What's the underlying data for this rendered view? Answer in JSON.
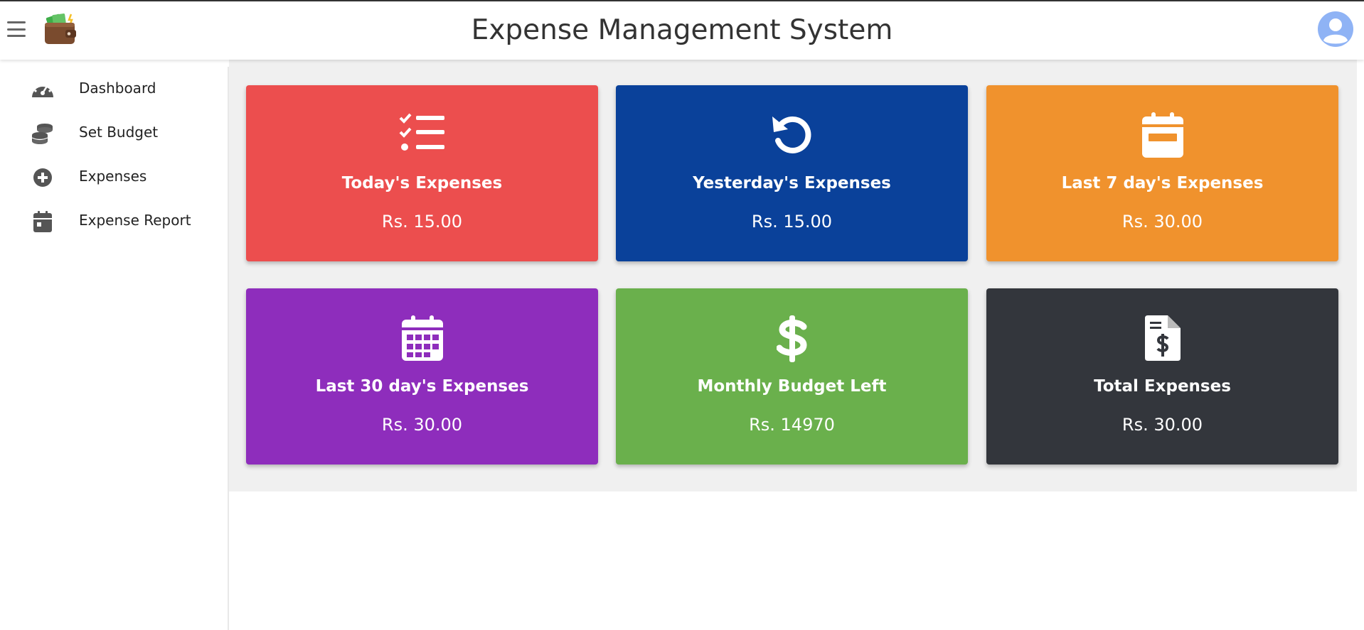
{
  "header": {
    "title": "Expense Management System"
  },
  "sidebar": {
    "items": [
      {
        "label": "Dashboard",
        "icon": "dashboard-gauge-icon"
      },
      {
        "label": "Set Budget",
        "icon": "coins-stack-icon"
      },
      {
        "label": "Expenses",
        "icon": "plus-circle-icon"
      },
      {
        "label": "Expense Report",
        "icon": "calendar-icon"
      }
    ]
  },
  "cards": [
    {
      "title": "Today's Expenses",
      "value": "Rs. 15.00",
      "color": "#ec4e4e",
      "icon": "list-check-icon"
    },
    {
      "title": "Yesterday's Expenses",
      "value": "Rs. 15.00",
      "color": "#0a419a",
      "icon": "rotate-left-icon"
    },
    {
      "title": "Last 7 day's Expenses",
      "value": "Rs. 30.00",
      "color": "#f0922d",
      "icon": "calendar-week-icon"
    },
    {
      "title": "Last 30 day's Expenses",
      "value": "Rs. 30.00",
      "color": "#8e2dbc",
      "icon": "calendar-days-icon"
    },
    {
      "title": "Monthly Budget Left",
      "value": "Rs. 14970",
      "color": "#6ab04c",
      "icon": "dollar-sign-icon"
    },
    {
      "title": "Total Expenses",
      "value": "Rs. 30.00",
      "color": "#33363c",
      "icon": "file-invoice-dollar-icon"
    }
  ],
  "colors": {
    "content_bg": "#f0f0f0",
    "sidebar_icon": "#555555",
    "avatar": "#8fb3f5"
  }
}
